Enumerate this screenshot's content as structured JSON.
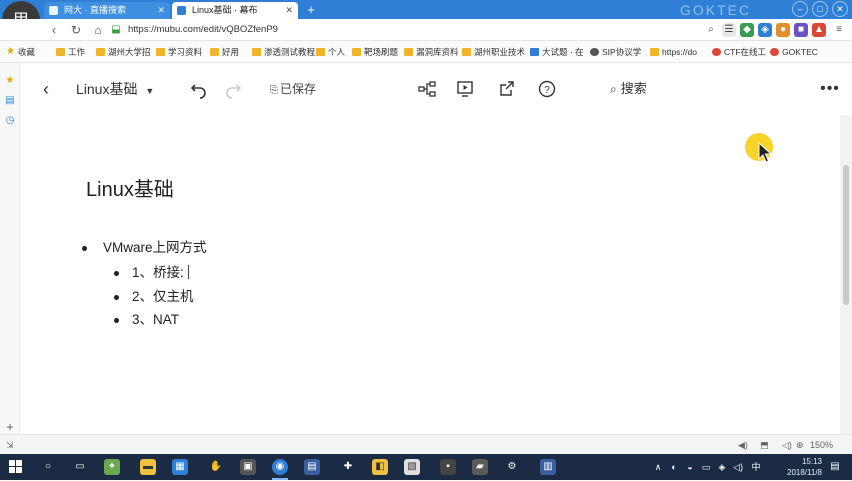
{
  "browser": {
    "avatar_text": "甲",
    "tabs": [
      {
        "title": "网大 · 直播搜索",
        "active": false,
        "icon_color": "#e8f4ff"
      },
      {
        "title": "Linux基础 · 幕布",
        "active": true,
        "icon_color": "#2f7fd6"
      }
    ],
    "url": "https://mubu.com/edit/vQBOZfenP9",
    "watermark": "GOKTEC",
    "window_controls": [
      "minimize-icon",
      "maximize-icon",
      "close-icon"
    ]
  },
  "bookmarks": [
    {
      "label": "收藏",
      "icon": "star"
    },
    {
      "label": "工作",
      "icon": "folder"
    },
    {
      "label": "湖州大学招",
      "icon": "folder"
    },
    {
      "label": "学习资料",
      "icon": "folder"
    },
    {
      "label": "好用",
      "icon": "folder"
    },
    {
      "label": "渗透测试教程",
      "icon": "folder"
    },
    {
      "label": "个人",
      "icon": "folder"
    },
    {
      "label": "靶场刷题",
      "icon": "folder"
    },
    {
      "label": "漏洞库资料",
      "icon": "folder"
    },
    {
      "label": "湖州职业技术",
      "icon": "folder"
    },
    {
      "label": "大试题 · 在",
      "icon": "blue"
    },
    {
      "label": "SIP协议学",
      "icon": "gray"
    },
    {
      "label": "https://do",
      "icon": "folder"
    },
    {
      "label": "CTF在线工",
      "icon": "red"
    },
    {
      "label": "GOKTEC",
      "icon": "red"
    }
  ],
  "app": {
    "doc_name": "Linux基础",
    "save_status": "已保存",
    "search_label": "搜索"
  },
  "document": {
    "title": "Linux基础",
    "items": [
      {
        "text": "VMware上网方式",
        "children": [
          {
            "text": "1、桥接:"
          },
          {
            "text": "2、仅主机"
          },
          {
            "text": "3、NAT"
          }
        ]
      }
    ]
  },
  "statusbar": {
    "zoom": "150%"
  },
  "taskbar": {
    "time": "15:13",
    "date": "2018/11/8"
  },
  "colors": {
    "tabstrip": "#2f7fd6",
    "taskbar": "#1b2b44",
    "cursor_highlight": "#f6d21c"
  }
}
